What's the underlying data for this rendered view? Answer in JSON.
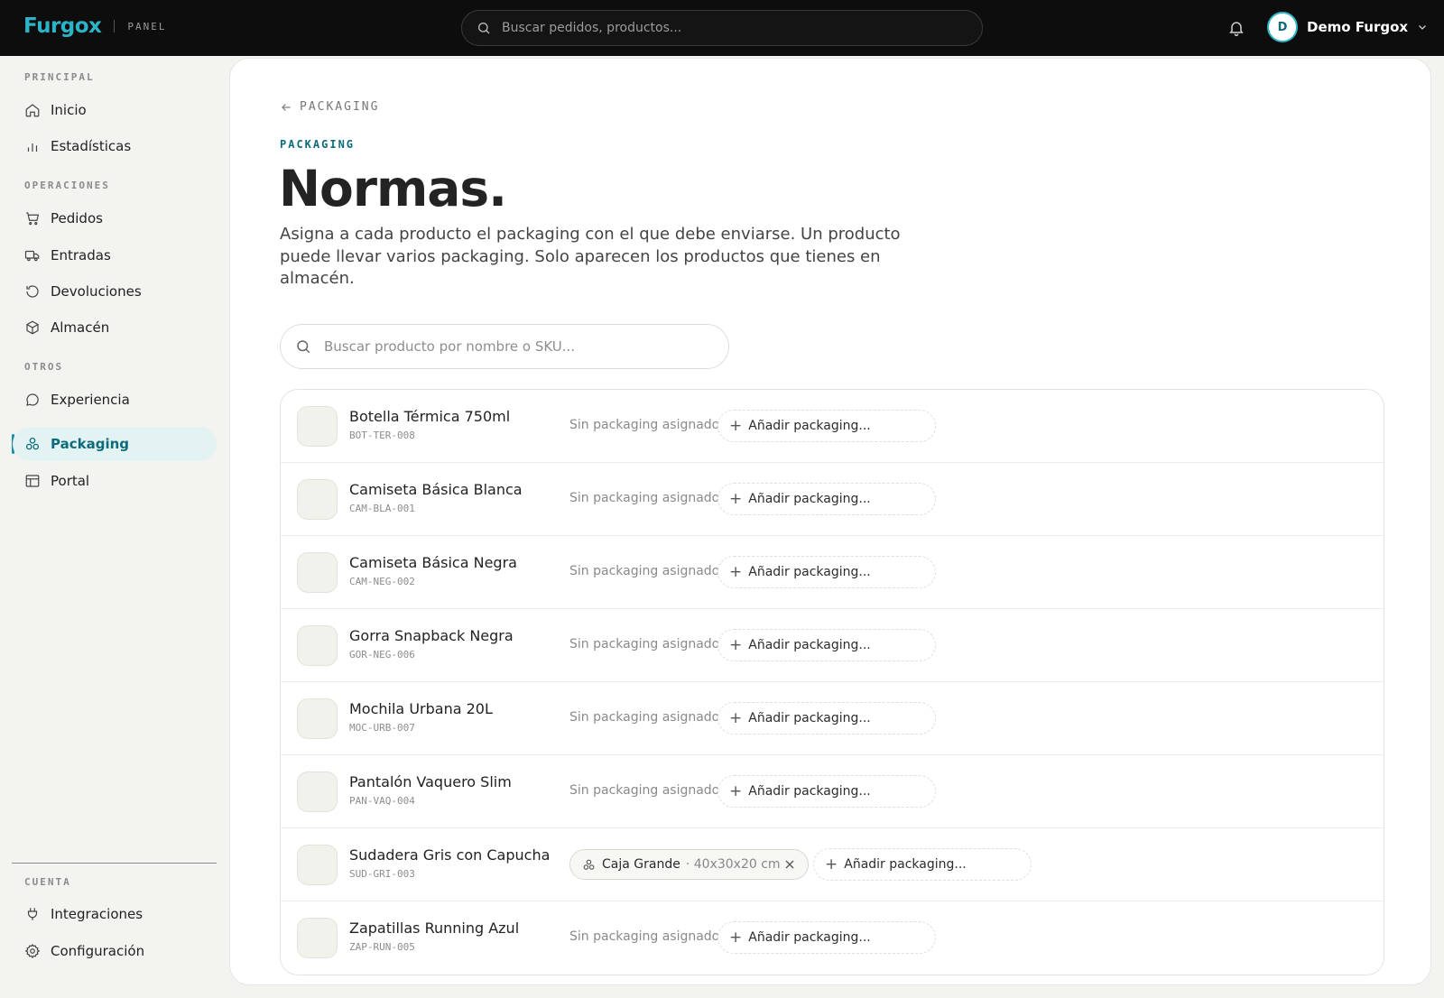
{
  "brand": {
    "logo": "Furgox",
    "panel_label": "PANEL"
  },
  "top_search": {
    "placeholder": "Buscar pedidos, productos..."
  },
  "user": {
    "initial": "D",
    "name": "Demo Furgox"
  },
  "sidebar": {
    "sections": [
      {
        "title": "PRINCIPAL",
        "items": [
          {
            "label": "Inicio",
            "icon": "home-icon"
          },
          {
            "label": "Estadísticas",
            "icon": "bar-chart-icon"
          }
        ]
      },
      {
        "title": "OPERACIONES",
        "items": [
          {
            "label": "Pedidos",
            "icon": "cart-icon"
          },
          {
            "label": "Entradas",
            "icon": "truck-icon"
          },
          {
            "label": "Devoluciones",
            "icon": "return-icon"
          },
          {
            "label": "Almacén",
            "icon": "box-icon"
          }
        ]
      },
      {
        "title": "OTROS",
        "items": [
          {
            "label": "Experiencia",
            "icon": "chat-icon"
          },
          {
            "label": "Packaging",
            "icon": "packaging-icon",
            "active": true
          },
          {
            "label": "Portal",
            "icon": "layout-icon"
          }
        ]
      },
      {
        "title": "CUENTA",
        "items": [
          {
            "label": "Integraciones",
            "icon": "plug-icon"
          },
          {
            "label": "Configuración",
            "icon": "gear-icon"
          }
        ]
      }
    ]
  },
  "page": {
    "back_label": "PACKAGING",
    "eyebrow": "PACKAGING",
    "title": "Normas.",
    "description": "Asigna a cada producto el packaging con el que debe enviarse. Un producto puede llevar varios packaging. Solo aparecen los productos que tienes en almacén.",
    "search_placeholder": "Buscar producto por nombre o SKU..."
  },
  "labels": {
    "no_packaging": "Sin packaging asignado",
    "add_packaging": "Añadir packaging..."
  },
  "products": [
    {
      "name": "Botella Térmica 750ml",
      "sku": "BOT-TER-008",
      "packaging": []
    },
    {
      "name": "Camiseta Básica Blanca",
      "sku": "CAM-BLA-001",
      "packaging": []
    },
    {
      "name": "Camiseta Básica Negra",
      "sku": "CAM-NEG-002",
      "packaging": []
    },
    {
      "name": "Gorra Snapback Negra",
      "sku": "GOR-NEG-006",
      "packaging": []
    },
    {
      "name": "Mochila Urbana 20L",
      "sku": "MOC-URB-007",
      "packaging": []
    },
    {
      "name": "Pantalón Vaquero Slim",
      "sku": "PAN-VAQ-004",
      "packaging": []
    },
    {
      "name": "Sudadera Gris con Capucha",
      "sku": "SUD-GRI-003",
      "packaging": [
        {
          "name": "Caja Grande",
          "dims": "· 40x30x20 cm"
        }
      ]
    },
    {
      "name": "Zapatillas Running Azul",
      "sku": "ZAP-RUN-005",
      "packaging": []
    }
  ],
  "colors": {
    "accent": "#2bb3c8",
    "accent_dark": "#0e6c7a",
    "topbar": "#0d0d0d"
  }
}
